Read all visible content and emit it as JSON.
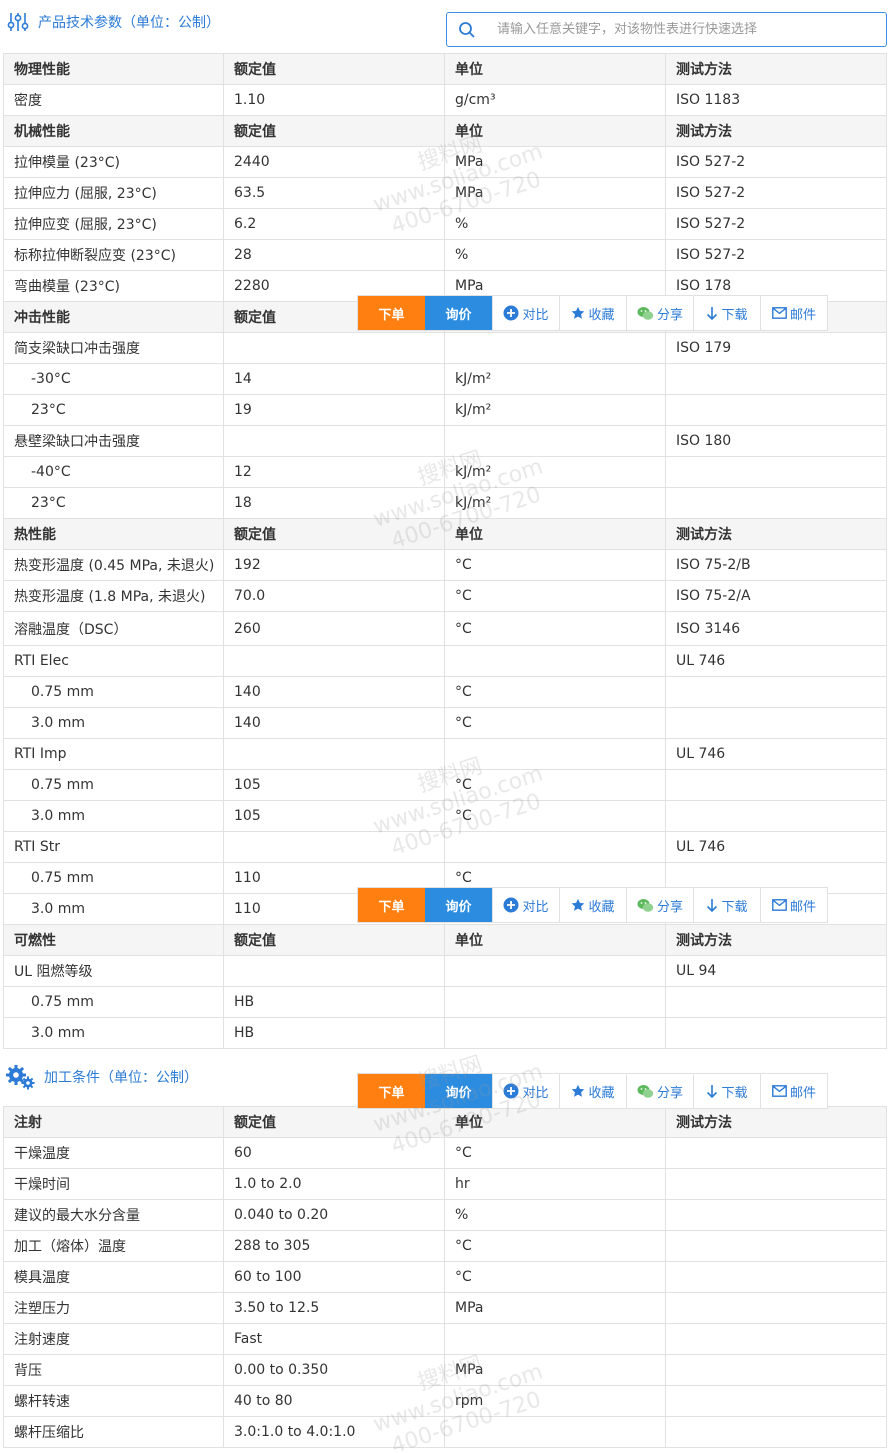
{
  "spec_section": {
    "title": "产品技术参数（单位：公制）"
  },
  "search": {
    "placeholder": "请输入任意关键字，对该物性表进行快速选择"
  },
  "toolbar": {
    "order": "下单",
    "inquiry": "询价",
    "compare": "对比",
    "favorite": "收藏",
    "share": "分享",
    "download": "下载",
    "mail": "邮件"
  },
  "spec_table": [
    {
      "type": "header",
      "cells": [
        "物理性能",
        "额定值",
        "单位",
        "测试方法"
      ]
    },
    {
      "type": "row",
      "cells": [
        "密度",
        "1.10",
        "g/cm³",
        "ISO 1183"
      ]
    },
    {
      "type": "header",
      "cells": [
        "机械性能",
        "额定值",
        "单位",
        "测试方法"
      ]
    },
    {
      "type": "row",
      "cells": [
        "拉伸模量 (23°C)",
        "2440",
        "MPa",
        "ISO 527-2"
      ]
    },
    {
      "type": "row",
      "cells": [
        "拉伸应力 (屈服, 23°C)",
        "63.5",
        "MPa",
        "ISO 527-2"
      ]
    },
    {
      "type": "row",
      "cells": [
        "拉伸应变 (屈服, 23°C)",
        "6.2",
        "%",
        "ISO 527-2"
      ]
    },
    {
      "type": "row",
      "cells": [
        "标称拉伸断裂应变 (23°C)",
        "28",
        "%",
        "ISO 527-2"
      ]
    },
    {
      "type": "row",
      "cells": [
        "弯曲模量 (23°C)",
        "2280",
        "MPa",
        "ISO 178"
      ]
    },
    {
      "type": "header",
      "cells": [
        "冲击性能",
        "额定值",
        "",
        ""
      ]
    },
    {
      "type": "row",
      "cells": [
        "简支梁缺口冲击强度",
        "",
        "",
        "ISO 179"
      ]
    },
    {
      "type": "sub",
      "cells": [
        "-30°C",
        "14",
        "kJ/m²",
        ""
      ]
    },
    {
      "type": "sub",
      "cells": [
        "23°C",
        "19",
        "kJ/m²",
        ""
      ]
    },
    {
      "type": "row",
      "cells": [
        "悬壁梁缺口冲击强度",
        "",
        "",
        "ISO 180"
      ]
    },
    {
      "type": "sub",
      "cells": [
        "-40°C",
        "12",
        "kJ/m²",
        ""
      ]
    },
    {
      "type": "sub",
      "cells": [
        "23°C",
        "18",
        "kJ/m²",
        ""
      ]
    },
    {
      "type": "header",
      "cells": [
        "热性能",
        "额定值",
        "单位",
        "测试方法"
      ]
    },
    {
      "type": "row",
      "cells": [
        "热变形温度 (0.45 MPa, 未退火)",
        "192",
        "°C",
        "ISO 75-2/B"
      ]
    },
    {
      "type": "row",
      "cells": [
        "热变形温度 (1.8 MPa, 未退火)",
        "70.0",
        "°C",
        "ISO 75-2/A"
      ]
    },
    {
      "type": "row",
      "cells": [
        "溶融温度（DSC）",
        "260",
        "°C",
        "ISO 3146"
      ]
    },
    {
      "type": "row",
      "cells": [
        "RTI Elec",
        "",
        "",
        "UL 746"
      ]
    },
    {
      "type": "sub",
      "cells": [
        "0.75 mm",
        "140",
        "°C",
        ""
      ]
    },
    {
      "type": "sub",
      "cells": [
        "3.0 mm",
        "140",
        "°C",
        ""
      ]
    },
    {
      "type": "row",
      "cells": [
        "RTI Imp",
        "",
        "",
        "UL 746"
      ]
    },
    {
      "type": "sub",
      "cells": [
        "0.75 mm",
        "105",
        "°C",
        ""
      ]
    },
    {
      "type": "sub",
      "cells": [
        "3.0 mm",
        "105",
        "°C",
        ""
      ]
    },
    {
      "type": "row",
      "cells": [
        "RTI Str",
        "",
        "",
        "UL 746"
      ]
    },
    {
      "type": "sub",
      "cells": [
        "0.75 mm",
        "110",
        "°C",
        ""
      ]
    },
    {
      "type": "sub",
      "cells": [
        "3.0 mm",
        "110",
        "",
        ""
      ]
    },
    {
      "type": "header",
      "cells": [
        "可燃性",
        "额定值",
        "单位",
        "测试方法"
      ]
    },
    {
      "type": "row",
      "cells": [
        "UL 阻燃等级",
        "",
        "",
        "UL 94"
      ]
    },
    {
      "type": "sub",
      "cells": [
        "0.75 mm",
        "HB",
        "",
        ""
      ]
    },
    {
      "type": "sub",
      "cells": [
        "3.0 mm",
        "HB",
        "",
        ""
      ]
    }
  ],
  "processing_section": {
    "title": "加工条件（单位：公制）"
  },
  "processing_table": [
    {
      "type": "header",
      "cells": [
        "注射",
        "额定值",
        "单位",
        "测试方法"
      ]
    },
    {
      "type": "row",
      "cells": [
        "干燥温度",
        "60",
        "°C",
        ""
      ]
    },
    {
      "type": "row",
      "cells": [
        "干燥时间",
        "1.0 to 2.0",
        "hr",
        ""
      ]
    },
    {
      "type": "row",
      "cells": [
        "建议的最大水分含量",
        "0.040 to 0.20",
        "%",
        ""
      ]
    },
    {
      "type": "row",
      "cells": [
        "加工（熔体）温度",
        "288 to 305",
        "°C",
        ""
      ]
    },
    {
      "type": "row",
      "cells": [
        "模具温度",
        "60 to 100",
        "°C",
        ""
      ]
    },
    {
      "type": "row",
      "cells": [
        "注塑压力",
        "3.50 to 12.5",
        "MPa",
        ""
      ]
    },
    {
      "type": "row",
      "cells": [
        "注射速度",
        "Fast",
        "",
        ""
      ]
    },
    {
      "type": "row",
      "cells": [
        "背压",
        "0.00 to 0.350",
        "MPa",
        ""
      ]
    },
    {
      "type": "row",
      "cells": [
        "螺杆转速",
        "40 to 80",
        "rpm",
        ""
      ]
    },
    {
      "type": "row",
      "cells": [
        "螺杆压缩比",
        "3.0:1.0 to 4.0:1.0",
        "",
        ""
      ]
    }
  ],
  "watermark": {
    "line1": "搜料网",
    "line2": "www.soliao.com",
    "line3": "400-6700-720"
  },
  "colors": {
    "accent": "#2c7bd6",
    "order": "#ff7f11",
    "inquiry": "#2c8ce0",
    "header_bg": "#f5f5f5"
  }
}
